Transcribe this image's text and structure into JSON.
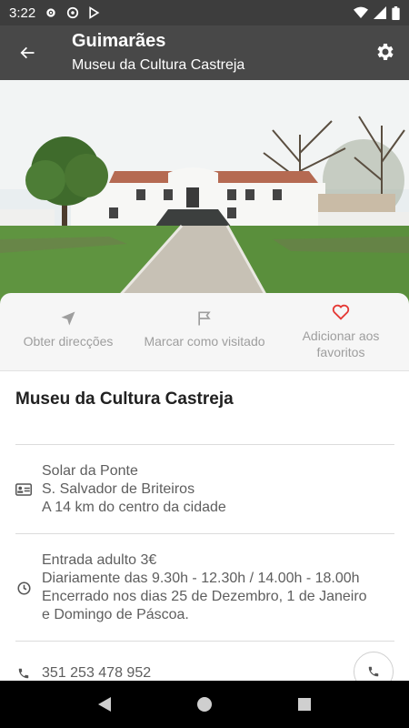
{
  "status_bar": {
    "time": "3:22"
  },
  "app_bar": {
    "title": "Guimarães",
    "subtitle": "Museu da Cultura Castreja"
  },
  "hero": {
    "image_label": "hero-photo"
  },
  "actions": [
    {
      "label": "Obter direcções",
      "icon": "navigation-arrow-icon"
    },
    {
      "label": "Marcar como visitado",
      "icon": "flag-icon"
    },
    {
      "label": "Adicionar aos favoritos",
      "icon": "heart-icon",
      "accent": "#e53935"
    }
  ],
  "place": {
    "name": "Museu da Cultura Castreja",
    "address_lines": [
      "Solar da Ponte",
      "S. Salvador de Briteiros",
      "A 14 km do centro da cidade"
    ],
    "hours_lines": [
      "Entrada adulto 3€",
      "Diariamente das 9.30h - 12.30h / 14.00h - 18.00h",
      "Encerrado nos dias 25 de Dezembro, 1 de Janeiro",
      "e Domingo de Páscoa."
    ],
    "phone": "351 253 478 952"
  },
  "colors": {
    "app_bar": "#484848",
    "status_bar": "#3d3d3d",
    "accent": "#e53935"
  }
}
